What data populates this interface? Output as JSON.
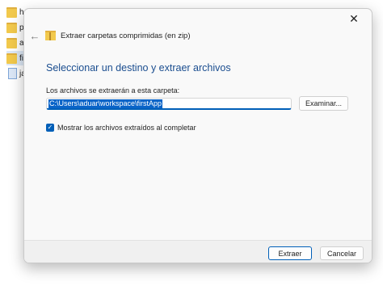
{
  "background_list": [
    {
      "label": "h",
      "type": "folder"
    },
    {
      "label": "p",
      "type": "folder"
    },
    {
      "label": "a",
      "type": "folder"
    },
    {
      "label": "fir",
      "type": "folder",
      "selected": true
    },
    {
      "label": "ja",
      "type": "file"
    }
  ],
  "dialog": {
    "close_icon": "close-icon",
    "back_icon": "back-arrow-icon",
    "title": "Extraer carpetas comprimidas (en zip)",
    "heading": "Seleccionar un destino y extraer archivos",
    "path_label": "Los archivos se extraerán a esta carpeta:",
    "path_value": "C:\\Users\\aduar\\workspace\\firstApp",
    "browse_label": "Examinar...",
    "show_files_label": "Mostrar los archivos extraídos al completar",
    "show_files_checked": true,
    "extract_label": "Extraer",
    "cancel_label": "Cancelar"
  },
  "colors": {
    "accent": "#005fb8",
    "heading": "#1a4d8f",
    "selection": "#0a64c8"
  }
}
